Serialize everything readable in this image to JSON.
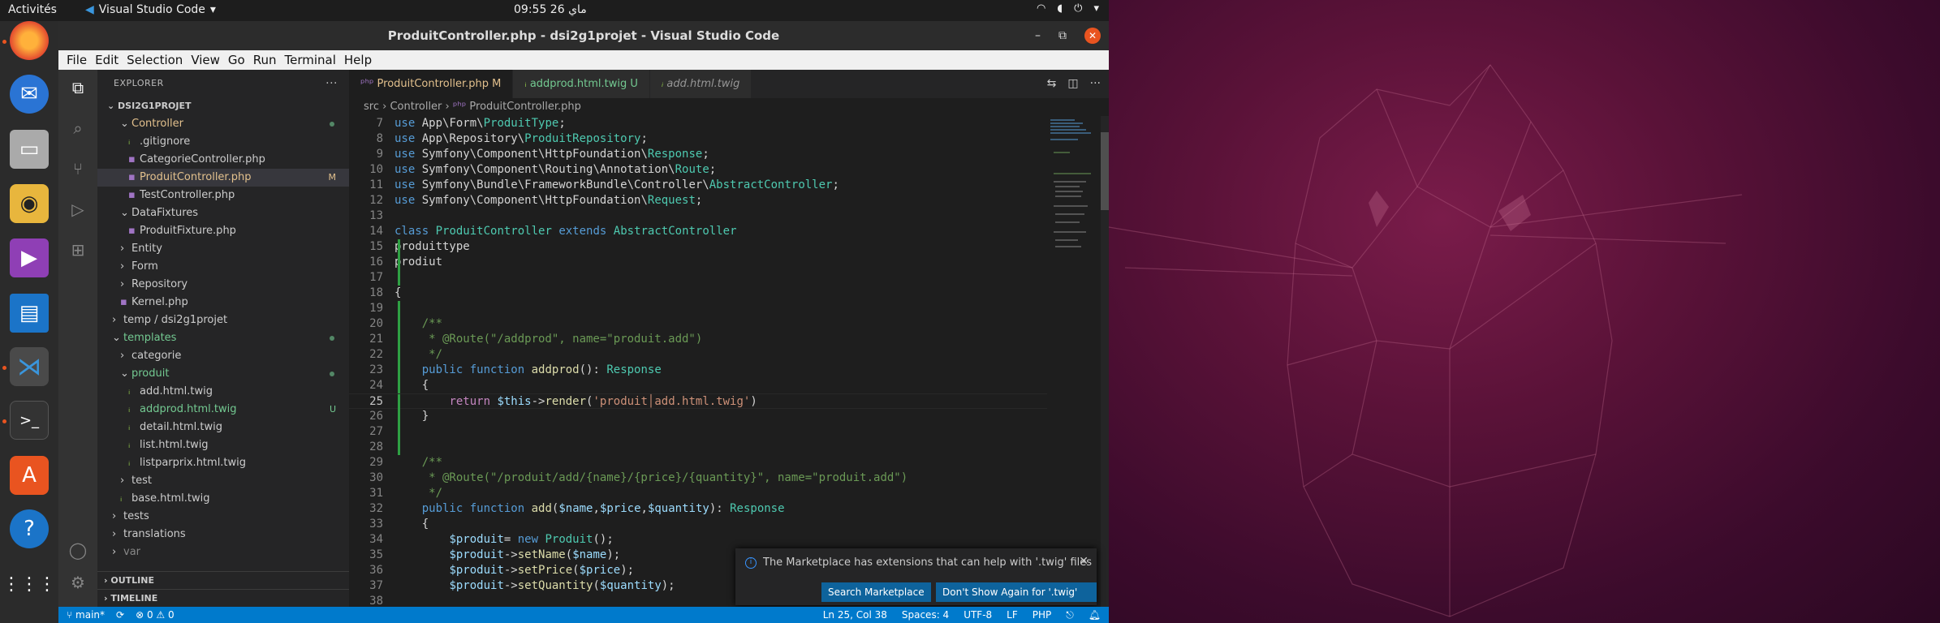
{
  "topbar": {
    "activities": "Activités",
    "app_name": "Visual Studio Code",
    "clock": "09:55  26 ماي",
    "tray": [
      "wifi-icon",
      "volume-icon",
      "power-icon"
    ]
  },
  "dock": {
    "items": [
      "firefox-icon",
      "thunderbird-icon",
      "files-icon",
      "rhythmbox-icon",
      "videos-icon",
      "writer-icon",
      "vscode-icon",
      "terminal-icon",
      "software-icon",
      "help-icon",
      "apps-grid-icon"
    ]
  },
  "window": {
    "title": "ProduitController.php - dsi2g1projet - Visual Studio Code",
    "menu": [
      "File",
      "Edit",
      "Selection",
      "View",
      "Go",
      "Run",
      "Terminal",
      "Help"
    ]
  },
  "explorer": {
    "title": "EXPLORER",
    "project": "DSI2G1PROJET",
    "rows": [
      {
        "label": "Controller",
        "indent": 1,
        "chev": "v",
        "color": "#e2c08d",
        "mark": "dot"
      },
      {
        "label": ".gitignore",
        "indent": 2,
        "chev": "",
        "color": "#ccc",
        "mark": ""
      },
      {
        "label": "CategorieController.php",
        "indent": 2,
        "chev": "",
        "color": "#ccc",
        "mark": ""
      },
      {
        "label": "ProduitController.php",
        "indent": 2,
        "chev": "",
        "color": "#e2c08d",
        "mark": "M",
        "selected": true
      },
      {
        "label": "TestController.php",
        "indent": 2,
        "chev": "",
        "color": "#ccc",
        "mark": ""
      },
      {
        "label": "DataFixtures",
        "indent": 1,
        "chev": "v",
        "color": "#ccc",
        "mark": ""
      },
      {
        "label": "ProduitFixture.php",
        "indent": 2,
        "chev": "",
        "color": "#ccc",
        "mark": ""
      },
      {
        "label": "Entity",
        "indent": 1,
        "chev": ">",
        "color": "#ccc",
        "mark": ""
      },
      {
        "label": "Form",
        "indent": 1,
        "chev": ">",
        "color": "#ccc",
        "mark": ""
      },
      {
        "label": "Repository",
        "indent": 1,
        "chev": ">",
        "color": "#ccc",
        "mark": ""
      },
      {
        "label": "Kernel.php",
        "indent": 1,
        "chev": "",
        "color": "#ccc",
        "mark": ""
      },
      {
        "label": "temp / dsi2g1projet",
        "indent": 0,
        "chev": ">",
        "color": "#ccc",
        "mark": ""
      },
      {
        "label": "templates",
        "indent": 0,
        "chev": "v",
        "color": "#73c991",
        "mark": "dot"
      },
      {
        "label": "categorie",
        "indent": 1,
        "chev": ">",
        "color": "#ccc",
        "mark": ""
      },
      {
        "label": "produit",
        "indent": 1,
        "chev": "v",
        "color": "#73c991",
        "mark": "dot"
      },
      {
        "label": "add.html.twig",
        "indent": 2,
        "chev": "",
        "color": "#ccc",
        "mark": ""
      },
      {
        "label": "addprod.html.twig",
        "indent": 2,
        "chev": "",
        "color": "#73c991",
        "mark": "U"
      },
      {
        "label": "detail.html.twig",
        "indent": 2,
        "chev": "",
        "color": "#ccc",
        "mark": ""
      },
      {
        "label": "list.html.twig",
        "indent": 2,
        "chev": "",
        "color": "#ccc",
        "mark": ""
      },
      {
        "label": "listparprix.html.twig",
        "indent": 2,
        "chev": "",
        "color": "#ccc",
        "mark": ""
      },
      {
        "label": "test",
        "indent": 1,
        "chev": ">",
        "color": "#ccc",
        "mark": ""
      },
      {
        "label": "base.html.twig",
        "indent": 1,
        "chev": "",
        "color": "#ccc",
        "mark": ""
      },
      {
        "label": "tests",
        "indent": 0,
        "chev": ">",
        "color": "#ccc",
        "mark": ""
      },
      {
        "label": "translations",
        "indent": 0,
        "chev": ">",
        "color": "#ccc",
        "mark": ""
      },
      {
        "label": "var",
        "indent": 0,
        "chev": ">",
        "color": "#888",
        "mark": ""
      }
    ],
    "outline": "OUTLINE",
    "timeline": "TIMELINE"
  },
  "tabs": [
    {
      "label": "ProduitController.php",
      "badge": "M",
      "active": true
    },
    {
      "label": "addprod.html.twig",
      "badge": "U",
      "active": false
    },
    {
      "label": "add.html.twig",
      "badge": "",
      "active": false
    }
  ],
  "breadcrumbs": [
    "src",
    "Controller",
    "ProduitController.php"
  ],
  "code": [
    {
      "n": "7",
      "html": "<span class=k>use</span> <span class=p>App\\Form\\</span><span class=t>ProduitType</span><span class=p>;</span>"
    },
    {
      "n": "8",
      "html": "<span class=k>use</span> <span class=p>App\\Repository\\</span><span class=t>ProduitRepository</span><span class=p>;</span>"
    },
    {
      "n": "9",
      "html": "<span class=k>use</span> <span class=p>Symfony\\Component\\HttpFoundation\\</span><span class=t>Response</span><span class=p>;</span>"
    },
    {
      "n": "10",
      "html": "<span class=k>use</span> <span class=p>Symfony\\Component\\Routing\\Annotation\\</span><span class=t>Route</span><span class=p>;</span>"
    },
    {
      "n": "11",
      "html": "<span class=k>use</span> <span class=p>Symfony\\Bundle\\FrameworkBundle\\Controller\\</span><span class=t>AbstractController</span><span class=p>;</span>"
    },
    {
      "n": "12",
      "html": "<span class=k>use</span> <span class=p>Symfony\\Component\\HttpFoundation\\</span><span class=t>Request</span><span class=p>;</span>"
    },
    {
      "n": "13",
      "html": ""
    },
    {
      "n": "14",
      "html": "<span class=k>class</span> <span class=t>ProduitController</span> <span class=k>extends</span> <span class=t>AbstractController</span>"
    },
    {
      "n": "15",
      "html": "<span class=p>produittype</span>",
      "mod": true
    },
    {
      "n": "16",
      "html": "<span class=p>prodiut</span>",
      "mod": true
    },
    {
      "n": "17",
      "html": "",
      "mod": true
    },
    {
      "n": "18",
      "html": "<span class=p>{</span>"
    },
    {
      "n": "19",
      "html": "",
      "mod": true
    },
    {
      "n": "20",
      "html": "    <span class=c>/**</span>",
      "mod": true
    },
    {
      "n": "21",
      "html": "<span class=c>     * @Route(\"/addprod\", name=\"produit.add\")</span>",
      "mod": true
    },
    {
      "n": "22",
      "html": "<span class=c>     */</span>",
      "mod": true
    },
    {
      "n": "23",
      "html": "    <span class=k>public</span> <span class=k>function</span> <span class=f>addprod</span><span class=p>(): </span><span class=t>Response</span>",
      "mod": true
    },
    {
      "n": "24",
      "html": "    <span class=p>{</span>",
      "mod": true
    },
    {
      "n": "25",
      "html": "        <span class=ctl>return</span> <span class=v>$this</span><span class=p>-></span><span class=f>render</span><span class=p>(</span><span class=s>'produit│add.html.twig'</span><span class=p>)</span>",
      "mod": true,
      "cur": true
    },
    {
      "n": "26",
      "html": "    <span class=p>}</span>",
      "mod": true
    },
    {
      "n": "27",
      "html": "",
      "mod": true
    },
    {
      "n": "28",
      "html": "",
      "mod": true
    },
    {
      "n": "29",
      "html": "    <span class=c>/**</span>"
    },
    {
      "n": "30",
      "html": "<span class=c>     * @Route(\"/produit/add/{name}/{price}/{quantity}\", name=\"produit.add\")</span>"
    },
    {
      "n": "31",
      "html": "<span class=c>     */</span>"
    },
    {
      "n": "32",
      "html": "    <span class=k>public</span> <span class=k>function</span> <span class=f>add</span><span class=p>(</span><span class=v>$name</span><span class=p>,</span><span class=v>$price</span><span class=p>,</span><span class=v>$quantity</span><span class=p>): </span><span class=t>Response</span>"
    },
    {
      "n": "33",
      "html": "    <span class=p>{</span>"
    },
    {
      "n": "34",
      "html": "        <span class=v>$produit</span><span class=p>= </span><span class=k>new</span> <span class=t>Produit</span><span class=p>();</span>"
    },
    {
      "n": "35",
      "html": "        <span class=v>$produit</span><span class=p>-></span><span class=f>setName</span><span class=p>(</span><span class=v>$name</span><span class=p>);</span>"
    },
    {
      "n": "36",
      "html": "        <span class=v>$produit</span><span class=p>-></span><span class=f>setPrice</span><span class=p>(</span><span class=v>$price</span><span class=p>);</span>"
    },
    {
      "n": "37",
      "html": "        <span class=v>$produit</span><span class=p>-></span><span class=f>setQuantity</span><span class=p>(</span><span class=v>$quantity</span><span class=p>);</span>"
    },
    {
      "n": "38",
      "html": ""
    }
  ],
  "notification": {
    "message": "The Marketplace has extensions that can help with '.twig' files",
    "btn_search": "Search Marketplace",
    "btn_dont_show": "Don't Show Again for '.twig' files"
  },
  "status": {
    "branch": "main*",
    "problems": "⊗ 0 ⚠ 0",
    "position": "Ln 25, Col 38",
    "spaces": "Spaces: 4",
    "encoding": "UTF-8",
    "eol": "LF",
    "language": "PHP"
  }
}
